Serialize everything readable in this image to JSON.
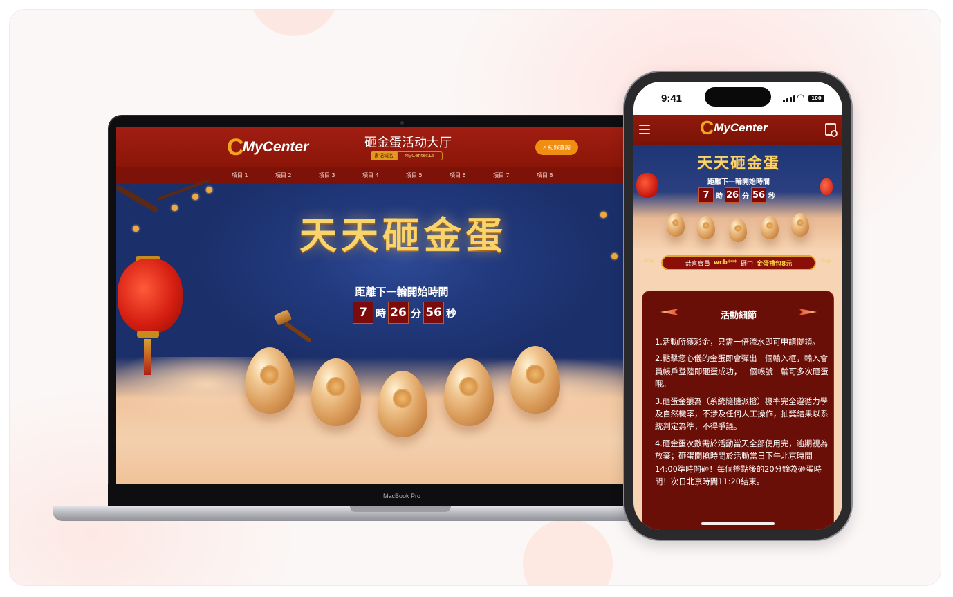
{
  "desktop": {
    "brand": {
      "mark": "C",
      "name": "MyCenter"
    },
    "site_title": "砸金蛋活动大厅",
    "domain_label": "書记域名",
    "domain_value": "MyCenter.La",
    "records_button": "紀錄查詢",
    "nav_items": [
      "項目 1",
      "項目 2",
      "項目 3",
      "項目 4",
      "項目 5",
      "項目 6",
      "項目 7",
      "項目 8"
    ],
    "hero_title": "天天砸金蛋",
    "countdown_label": "距離下一輪開始時間",
    "countdown": {
      "hours": "7",
      "hours_unit": "時",
      "minutes": "26",
      "minutes_unit": "分",
      "seconds": "56",
      "seconds_unit": "秒"
    },
    "device_label": "MacBook Pro"
  },
  "mobile": {
    "status_time": "9:41",
    "battery": "100",
    "brand": {
      "mark": "C",
      "name": "MyCenter"
    },
    "hero_title": "天天砸金蛋",
    "countdown_label": "距離下一輪開始時間",
    "countdown": {
      "hours": "7",
      "hours_unit": "時",
      "minutes": "26",
      "minutes_unit": "分",
      "seconds": "56",
      "seconds_unit": "秒"
    },
    "winner": {
      "prefix": "恭喜會員",
      "user": "wcb***",
      "mid": "砸中",
      "prize": "金蛋禮包8元"
    },
    "details_title": "活動細節",
    "rules": [
      "1.活動所獲彩金，只需一倍流水即可申請提領。",
      "2.點擊您心儀的金蛋即會彈出一個輸入框，輸入會員帳戶登陸即砸蛋成功，一個帳號一輪可多次砸蛋哦。",
      "3.砸蛋金額為（系統隨機派搶）機率完全遵循力學及自然機率，不涉及任何人工操作，抽獎結果以系統判定為準，不得爭議。",
      "4.砸金蛋次數需於活動當天全部使用完，逾期視為放棄；砸蛋開搶時間於活動當日下午北京時間14:00準時開砸！每個整點後的20分鐘為砸蛋時間！次日北京時間11:20結束。"
    ]
  },
  "colors": {
    "header_red": "#8f1a0c",
    "gold": "#f8d46a",
    "accent_orange": "#f08e12",
    "panel_red": "#6a0f07"
  }
}
